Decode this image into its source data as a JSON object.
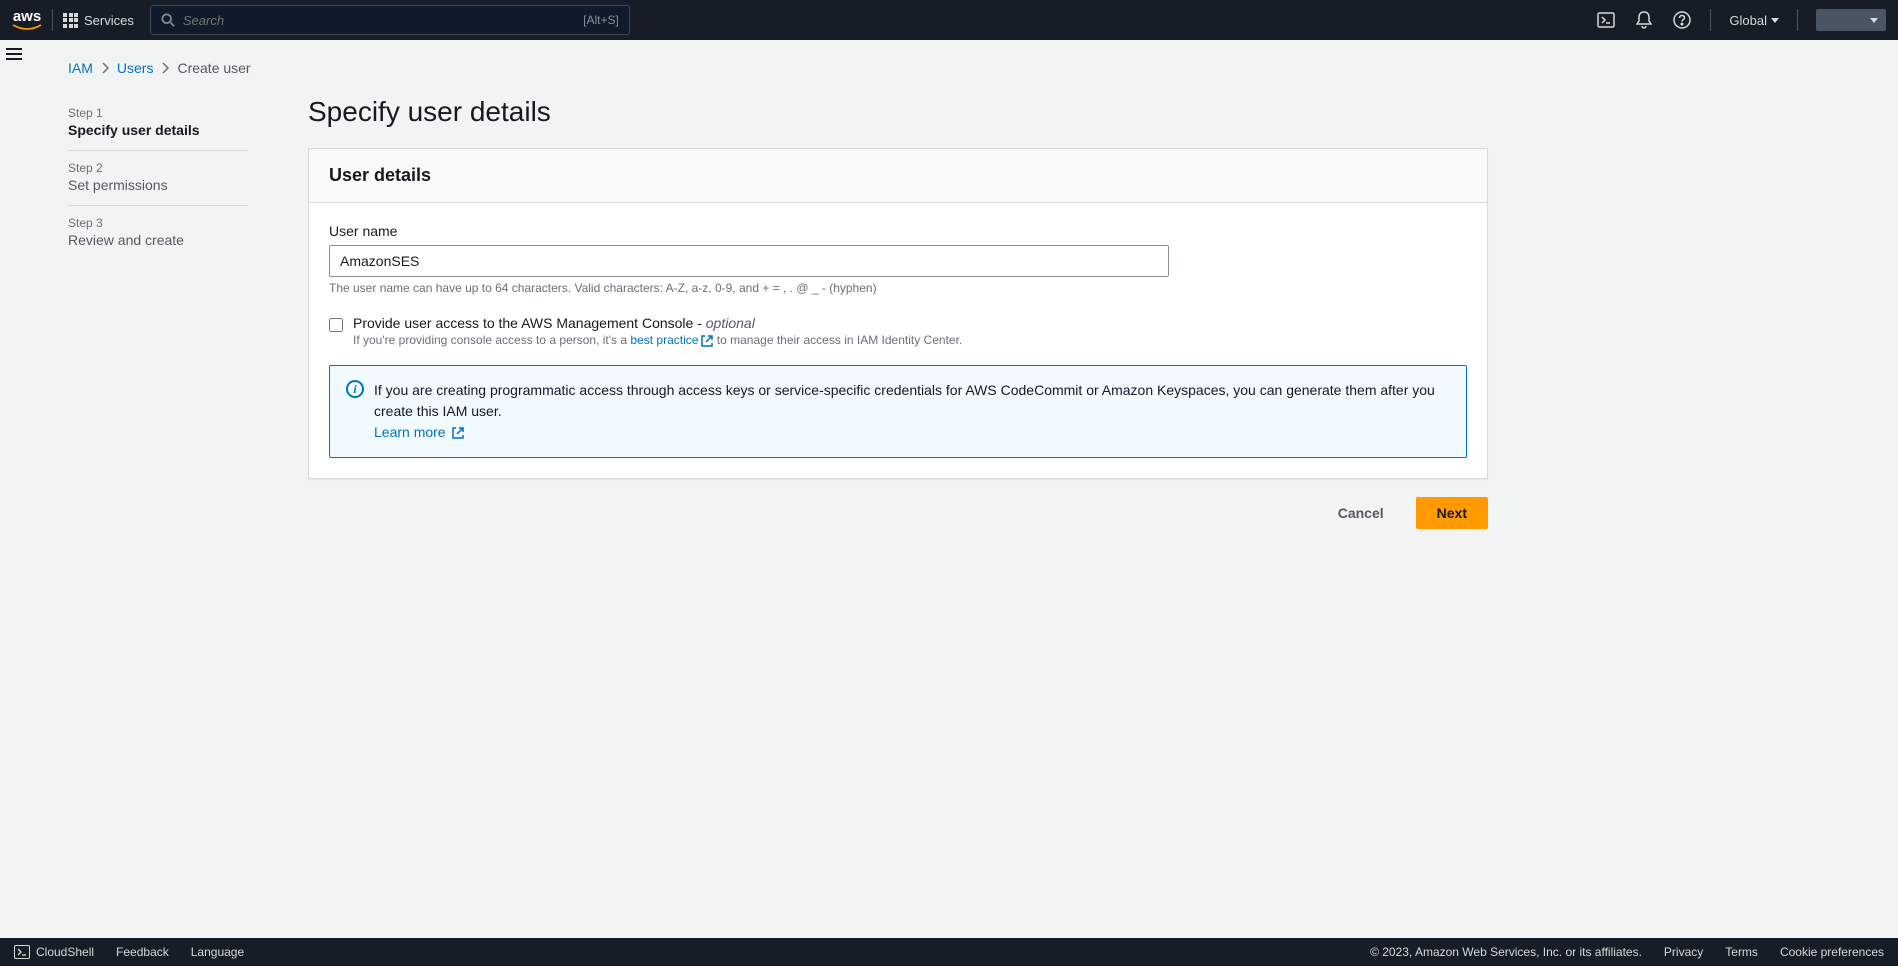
{
  "topnav": {
    "services_label": "Services",
    "search_placeholder": "Search",
    "search_hint": "[Alt+S]",
    "region": "Global"
  },
  "breadcrumb": {
    "iam": "IAM",
    "users": "Users",
    "current": "Create user"
  },
  "steps": [
    {
      "num": "Step 1",
      "name": "Specify user details"
    },
    {
      "num": "Step 2",
      "name": "Set permissions"
    },
    {
      "num": "Step 3",
      "name": "Review and create"
    }
  ],
  "page": {
    "title": "Specify user details",
    "panel_title": "User details",
    "username_label": "User name",
    "username_value": "AmazonSES",
    "username_hint": "The user name can have up to 64 characters. Valid characters: A-Z, a-z, 0-9, and + = , . @ _ - (hyphen)",
    "console_access_label_pre": "Provide user access to the AWS Management Console - ",
    "console_access_label_opt": "optional",
    "console_access_sub_pre": "If you're providing console access to a person, it's a ",
    "console_access_sub_link": "best practice",
    "console_access_sub_post": " to manage their access in IAM Identity Center.",
    "info_text": "If you are creating programmatic access through access keys or service-specific credentials for AWS CodeCommit or Amazon Keyspaces, you can generate them after you create this IAM user.",
    "info_link": "Learn more",
    "cancel_label": "Cancel",
    "next_label": "Next"
  },
  "footer": {
    "cloudshell": "CloudShell",
    "feedback": "Feedback",
    "language": "Language",
    "copyright": "© 2023, Amazon Web Services, Inc. or its affiliates.",
    "privacy": "Privacy",
    "terms": "Terms",
    "cookies": "Cookie preferences"
  }
}
